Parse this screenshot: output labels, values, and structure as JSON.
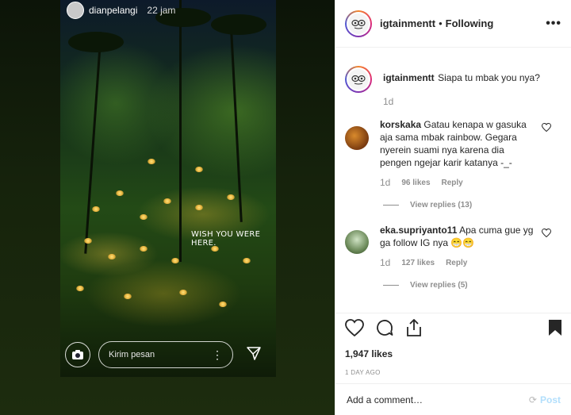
{
  "story": {
    "username": "dianpelangi",
    "time": "22 jam",
    "overlay_text": "WISH YOU WERE HERE.",
    "message_placeholder": "Kirim pesan"
  },
  "header": {
    "username": "igtainmentt",
    "separator": "•",
    "follow_status": "Following",
    "more_label": "•••"
  },
  "caption": {
    "username": "igtainmentt",
    "text": "Siapa tu mbak you nya?",
    "age": "1d"
  },
  "comments": [
    {
      "username": "korskaka",
      "text": "Gatau kenapa w gasuka aja sama mbak rainbow. Gegara nyerein suami nya karena dia pengen ngejar karir katanya -_-",
      "age": "1d",
      "likes": "96 likes",
      "reply_label": "Reply",
      "view_replies": "View replies (13)"
    },
    {
      "username": "eka.supriyanto11",
      "text": "Apa cuma gue yg ga follow IG nya 😁😁",
      "age": "1d",
      "likes": "127 likes",
      "reply_label": "Reply",
      "view_replies": "View replies (5)"
    }
  ],
  "post": {
    "likes": "1,947 likes",
    "date": "1 DAY AGO",
    "add_comment_placeholder": "Add a comment…",
    "post_label": "Post"
  },
  "colors": {
    "text": "#262626",
    "muted": "#8e8e8e",
    "post_disabled": "#b2dffc",
    "border": "#efefef"
  }
}
